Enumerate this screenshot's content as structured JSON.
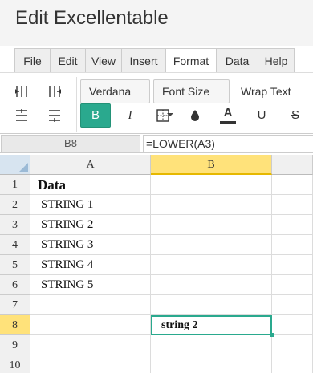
{
  "app": {
    "title": "Edit Excellentable"
  },
  "tabs": [
    {
      "label": "File"
    },
    {
      "label": "Edit"
    },
    {
      "label": "View"
    },
    {
      "label": "Insert"
    },
    {
      "label": "Format",
      "active": true
    },
    {
      "label": "Data"
    },
    {
      "label": "Help"
    }
  ],
  "toolbar": {
    "font_family": "Verdana",
    "font_size": "Font Size",
    "wrap_text": "Wrap Text",
    "bold": "B",
    "italic": "I",
    "underline": "U",
    "strikethrough": "S",
    "text_color_letter": "A",
    "accent_color": "#2aa98e",
    "icons": [
      "insert-column-left-icon",
      "insert-column-right-icon",
      "insert-row-above-icon",
      "insert-row-below-icon",
      "borders-icon",
      "fill-color-icon",
      "text-color-icon"
    ]
  },
  "formula_bar": {
    "cell_ref": "B8",
    "formula": "=LOWER(A3)"
  },
  "grid": {
    "columns": [
      "A",
      "B",
      ""
    ],
    "selected_column": "B",
    "rows": [
      {
        "num": "1",
        "a": "Data",
        "b": ""
      },
      {
        "num": "2",
        "a": "STRING 1",
        "b": ""
      },
      {
        "num": "3",
        "a": "STRING 2",
        "b": ""
      },
      {
        "num": "4",
        "a": "STRING 3",
        "b": ""
      },
      {
        "num": "5",
        "a": "STRING 4",
        "b": ""
      },
      {
        "num": "6",
        "a": "STRING 5",
        "b": ""
      },
      {
        "num": "7",
        "a": "",
        "b": ""
      },
      {
        "num": "8",
        "a": "",
        "b": "string 2"
      },
      {
        "num": "9",
        "a": "",
        "b": ""
      },
      {
        "num": "10",
        "a": "",
        "b": ""
      }
    ],
    "selected_row": "8"
  }
}
